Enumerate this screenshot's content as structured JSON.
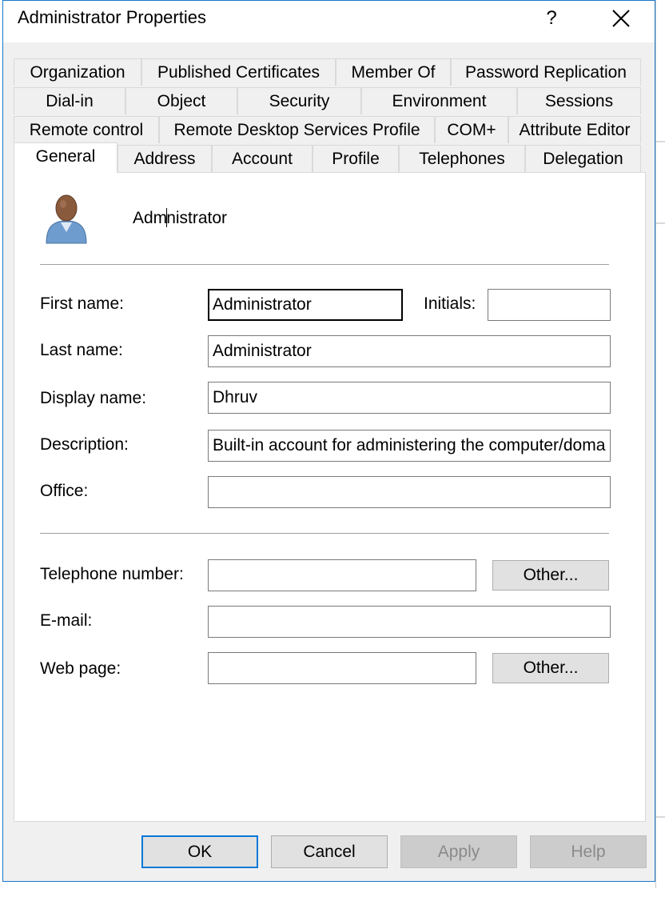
{
  "window": {
    "title": "Administrator Properties",
    "help_glyph": "?"
  },
  "tabs": {
    "row1": [
      "Organization",
      "Published Certificates",
      "Member Of",
      "Password Replication"
    ],
    "row2": [
      "Dial-in",
      "Object",
      "Security",
      "Environment",
      "Sessions"
    ],
    "row3": [
      "Remote control",
      "Remote Desktop Services Profile",
      "COM+",
      "Attribute Editor"
    ],
    "row4": [
      "General",
      "Address",
      "Account",
      "Profile",
      "Telephones",
      "Delegation"
    ],
    "active": "General"
  },
  "general": {
    "user_icon": "user-icon",
    "name_before_caret": "Adm",
    "name_after_caret": "nistrator",
    "labels": {
      "first_name": "First name:",
      "initials": "Initials:",
      "last_name": "Last name:",
      "display_name": "Display name:",
      "description": "Description:",
      "office": "Office:",
      "telephone": "Telephone number:",
      "email": "E-mail:",
      "web_page": "Web page:"
    },
    "values": {
      "first_name": "Administrator",
      "initials": "",
      "last_name": "Administrator",
      "display_name": "Dhruv",
      "description": "Built-in account for administering the computer/doma",
      "office": "",
      "telephone": "",
      "email": "",
      "web_page": ""
    },
    "other_label": "Other..."
  },
  "buttons": {
    "ok": "OK",
    "cancel": "Cancel",
    "apply": "Apply",
    "help": "Help"
  },
  "colors": {
    "accent": "#0078d7",
    "border": "#1979ca",
    "dialog_bg": "#f0f0f0"
  }
}
